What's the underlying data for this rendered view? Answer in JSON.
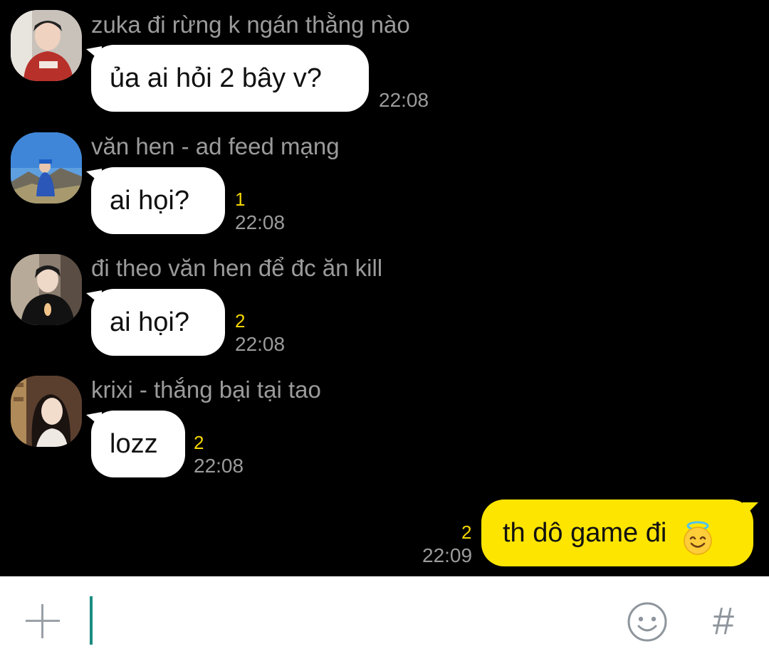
{
  "messages": [
    {
      "sender": "zuka đi rừng k ngán thằng nào",
      "text": "ủa ai hỏi 2 bây v?",
      "unread": "",
      "time": "22:08"
    },
    {
      "sender": "văn hen - ad feed mạng",
      "text": "ai họi?",
      "unread": "1",
      "time": "22:08"
    },
    {
      "sender": "đi theo văn hen để đc ăn kill",
      "text": "ai họi?",
      "unread": "2",
      "time": "22:08"
    },
    {
      "sender": "krixi - thắng bại tại tao",
      "text": "lozz",
      "unread": "2",
      "time": "22:08"
    }
  ],
  "outgoing": {
    "text": "th dô game đi",
    "emoji": "😇",
    "emoji_name": "smiling-face-with-halo",
    "unread": "2",
    "time": "22:09"
  },
  "composer": {
    "placeholder": "",
    "plus_icon": "plus-icon",
    "emoji_icon": "emoji-icon",
    "hash_label": "#"
  },
  "colors": {
    "background": "#000000",
    "incoming_bubble": "#ffffff",
    "outgoing_bubble": "#fee500",
    "unread": "#f5d600",
    "meta_text": "#9b9b9b",
    "caret": "#1a8c7f"
  }
}
